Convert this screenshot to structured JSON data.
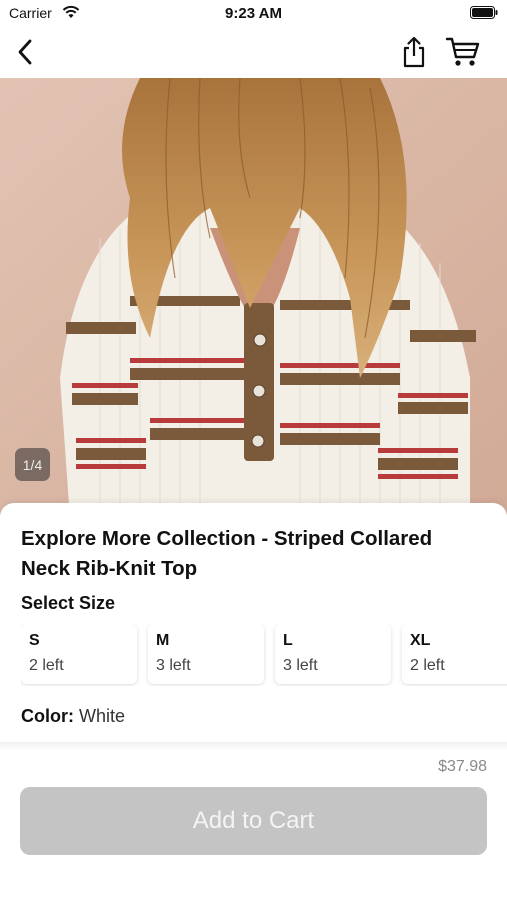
{
  "status_bar": {
    "carrier": "Carrier",
    "time": "9:23 AM"
  },
  "nav": {
    "icons": [
      "chevron-left-icon",
      "share-icon",
      "cart-icon"
    ]
  },
  "gallery": {
    "counter": "1/4"
  },
  "product": {
    "title": "Explore More Collection - Striped Collared Neck Rib-Knit Top",
    "size_heading": "Select Size",
    "sizes": [
      {
        "name": "S",
        "stock": "2 left"
      },
      {
        "name": "M",
        "stock": "3 left"
      },
      {
        "name": "L",
        "stock": "3 left"
      },
      {
        "name": "XL",
        "stock": "2 left"
      }
    ],
    "color_label": "Color:",
    "color_value": "White"
  },
  "footer": {
    "price": "$37.98",
    "add_to_cart_label": "Add to Cart"
  },
  "colors": {
    "button_disabled": "#c4c4c4",
    "stripe_brown": "#7a5a3a",
    "stripe_red": "#b83a3a"
  }
}
